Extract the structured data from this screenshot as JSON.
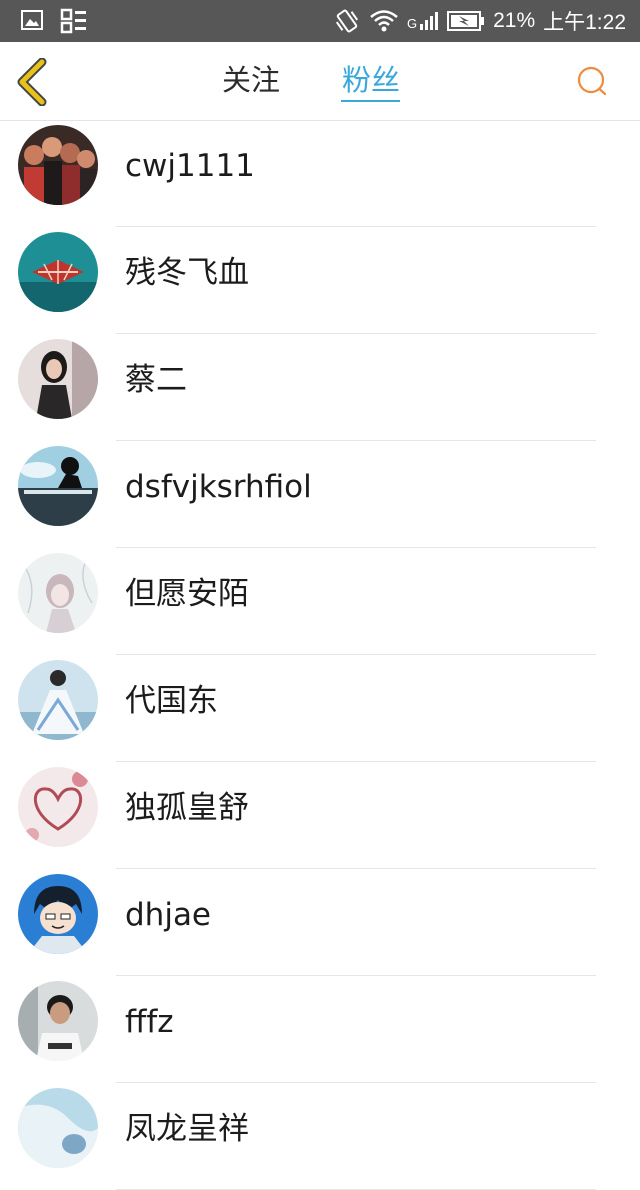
{
  "status_bar": {
    "battery_percent": "21%",
    "time": "上午1:22",
    "network_label": "G",
    "icons": [
      "gallery-notification-icon",
      "app-notification-icon",
      "vibrate-icon",
      "wifi-icon",
      "signal-icon",
      "battery-icon"
    ]
  },
  "header": {
    "back_icon": "chevron-left-icon",
    "tabs": [
      {
        "label": "关注",
        "selected": false
      },
      {
        "label": "粉丝",
        "selected": true
      }
    ],
    "search_icon": "search-icon",
    "accent_color": "#3aa8db",
    "back_icon_color": "#e8c21a",
    "search_icon_color": "#f08a3c"
  },
  "fans": [
    {
      "name": "cwj1111"
    },
    {
      "name": "残冬飞血"
    },
    {
      "name": "蔡二"
    },
    {
      "name": "dsfvjksrhfiol"
    },
    {
      "name": "但愿安陌"
    },
    {
      "name": "代国东"
    },
    {
      "name": "独孤皇舒"
    },
    {
      "name": "dhjae"
    },
    {
      "name": "fffz"
    },
    {
      "name": "凤龙呈祥"
    }
  ]
}
